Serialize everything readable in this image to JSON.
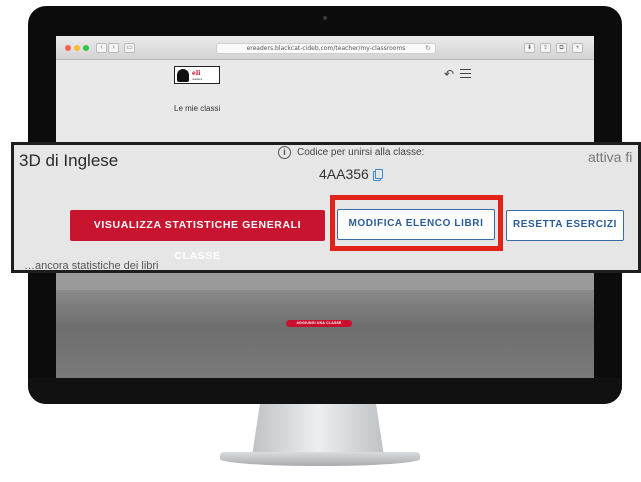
{
  "browser": {
    "url": "ereaders.blackcat-cideb.com/teacher/my-classrooms",
    "back_symbol": "‹",
    "forward_symbol": "›",
    "sidebar_symbol": "▭",
    "reload_symbol": "↻",
    "toolbar_icons": [
      "⬇",
      "⇪",
      "⧉",
      "+"
    ]
  },
  "app": {
    "logo_text": "eli",
    "logo_subtext": "readers",
    "back_symbol": "↶",
    "page_title": "Le mie classi",
    "add_class_label": "AGGIUNGI UNA CLASSE"
  },
  "classroom": {
    "name": "3D di Inglese",
    "code_label": "Codice per unirsi alla classe:",
    "info_symbol": "i",
    "code": "4AA356",
    "status_text": "attiva fi",
    "buttons": {
      "stats": "VISUALIZZA STATISTICHE GENERALI CLASSE",
      "edit_books": "MODIFICA ELENCO LIBRI",
      "reset": "RESETTA ESERCIZI"
    },
    "cut_text": "…ancora statistiche dei libri"
  },
  "colors": {
    "accent_red": "#c8142e",
    "highlight_red": "#e2231a",
    "outline_blue": "#3a6aa4",
    "copy_icon_blue": "#3a8ad6"
  },
  "icons": {
    "copy": "copy-icon",
    "info": "info-icon",
    "menu": "hamburger-menu-icon",
    "back": "back-arrow-icon"
  }
}
